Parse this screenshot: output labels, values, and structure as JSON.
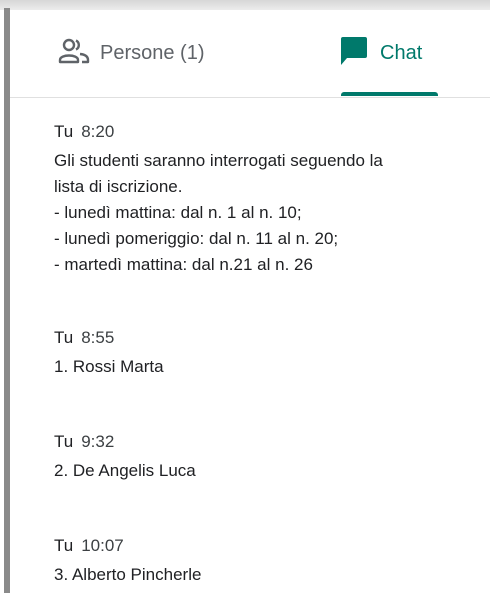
{
  "tabs": {
    "people": {
      "label": "Persone (1)",
      "icon": "people-icon"
    },
    "chat": {
      "label": "Chat",
      "icon": "chat-icon",
      "active": true
    }
  },
  "colors": {
    "accent": "#00796b",
    "text": "#202124",
    "muted": "#5f6368"
  },
  "messages": [
    {
      "author": "Tu",
      "time": "8:20",
      "lines": [
        "Gli studenti saranno interrogati seguendo la",
        "lista di iscrizione.",
        "- lunedì mattina: dal n. 1 al n. 10;",
        "- lunedì pomeriggio: dal n. 11 al n. 20;",
        "- martedì mattina: dal n.21 al n. 26"
      ]
    },
    {
      "author": "Tu",
      "time": "8:55",
      "lines": [
        "1. Rossi Marta"
      ]
    },
    {
      "author": "Tu",
      "time": "9:32",
      "lines": [
        "2. De Angelis Luca"
      ]
    },
    {
      "author": "Tu",
      "time": "10:07",
      "lines": [
        "3. Alberto Pincherle"
      ]
    }
  ]
}
